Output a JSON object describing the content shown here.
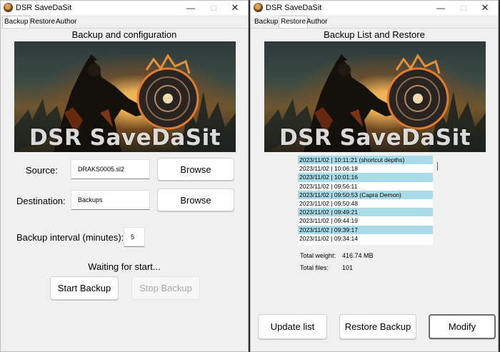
{
  "left_window": {
    "title": "DSR SaveDaSit",
    "tabs": [
      "Backup",
      "Restore",
      "Author"
    ],
    "heading": "Backup and configuration",
    "banner_caption": "DSR SaveDaSit",
    "source_label": "Source:",
    "source_value": "DRAKS0005.sl2",
    "destination_label": "Destination:",
    "destination_value": "Backups",
    "browse_label": "Browse",
    "interval_label": "Backup interval (minutes):",
    "interval_value": "5",
    "status": "Waiting for start...",
    "start_label": "Start Backup",
    "stop_label": "Stop Backup"
  },
  "right_window": {
    "title": "DSR SaveDaSit",
    "tabs": [
      "Backup",
      "Restore",
      "Author"
    ],
    "heading": "Backup List and Restore",
    "banner_caption": "DSR SaveDaSit",
    "backups": [
      {
        "text": "2023/11/02 | 10:11:21 (shortcut depths)",
        "highlighted": true
      },
      {
        "text": "2023/11/02 | 10:06:18",
        "highlighted": false
      },
      {
        "text": "2023/11/02 | 10:01:16",
        "highlighted": true
      },
      {
        "text": "2023/11/02 | 09:56:11",
        "highlighted": false
      },
      {
        "text": "2023/11/02 | 09:50:53 (Capra Demon)",
        "highlighted": true
      },
      {
        "text": "2023/11/02 | 09:50:48",
        "highlighted": false
      },
      {
        "text": "2023/11/02 | 09:49:21",
        "highlighted": true
      },
      {
        "text": "2023/11/02 | 09:44:19",
        "highlighted": false
      },
      {
        "text": "2023/11/02 | 09:39:17",
        "highlighted": true
      },
      {
        "text": "2023/11/02 | 09:34:14",
        "highlighted": false
      }
    ],
    "total_weight_label": "Total weight:",
    "total_weight_value": "416.74 MB",
    "total_files_label": "Total files:",
    "total_files_value": "101",
    "update_label": "Update list",
    "restore_label": "Restore Backup",
    "modify_label": "Modify"
  },
  "colors": {
    "list_highlight": "#a9dce8",
    "window_bg": "#f0f0f0"
  },
  "icons": {
    "app": "dark-souls-app-icon",
    "minimize": "minimize-icon",
    "maximize": "maximize-icon",
    "close": "close-icon"
  }
}
